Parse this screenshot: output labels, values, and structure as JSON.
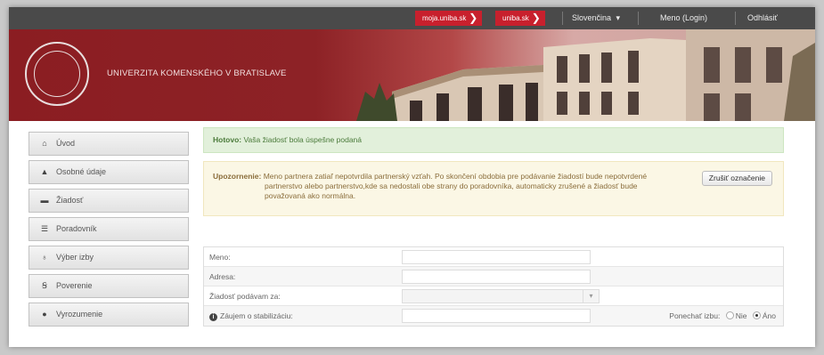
{
  "topbar": {
    "moja_uniba": "moja.uniba.sk",
    "uniba": "uniba.sk",
    "language": "Slovenčina",
    "language_caret": "▾",
    "login": "Meno (Login)",
    "logout": "Odhlásiť",
    "arrow": "❯"
  },
  "header": {
    "university_name": "UNIVERZITA KOMENSKÉHO V BRATISLAVE"
  },
  "sidebar": {
    "items": [
      {
        "label": "Úvod",
        "icon": "home-icon",
        "glyph": "⌂"
      },
      {
        "label": "Osobné údaje",
        "icon": "user-icon",
        "glyph": "▲"
      },
      {
        "label": "Žiadosť",
        "icon": "folder-icon",
        "glyph": "▬"
      },
      {
        "label": "Poradovník",
        "icon": "list-icon",
        "glyph": "☰"
      },
      {
        "label": "Výber izby",
        "icon": "bulb-icon",
        "glyph": "♁"
      },
      {
        "label": "Poverenie",
        "icon": "stamp-icon",
        "glyph": "Ꞩ"
      },
      {
        "label": "Vyrozumenie",
        "icon": "info-icon",
        "glyph": "●"
      }
    ]
  },
  "alerts": {
    "success_label": "Hotovo:",
    "success_text": "Vaša žiadosť bola úspešne podaná",
    "warning_label": "Upozornenie:",
    "warning_text_1": "Meno partnera  zatiaľ nepotvrdila partnerský vzťah. Po skončení obdobia pre podávanie žiadostí bude nepotvrdené",
    "warning_text_2": "partnerstvo alebo partnerstvo,kde sa nedostali obe strany do poradovníka, automaticky zrušené a žiadosť bude",
    "warning_text_3": "považovaná ako normálna.",
    "cancel_button": "Zrušiť označenie"
  },
  "form": {
    "name_label": "Meno:",
    "name_value": "",
    "address_label": "Adresa:",
    "address_value": "",
    "request_label": "Žiadosť podávam za:",
    "request_value": "",
    "stabilization_label": "Záujem o stabilizáciu:",
    "stabilization_value": "",
    "keep_room_label": "Ponechať izbu:",
    "keep_room_no": "Nie",
    "keep_room_yes": "Áno",
    "keep_room_selected": "Áno",
    "select_caret": "▾",
    "info_glyph": "i"
  },
  "colors": {
    "brand_red": "#c8202d",
    "header_red": "#8b1d22",
    "success_bg": "#e2f0db",
    "warning_bg": "#fbf7e5"
  }
}
